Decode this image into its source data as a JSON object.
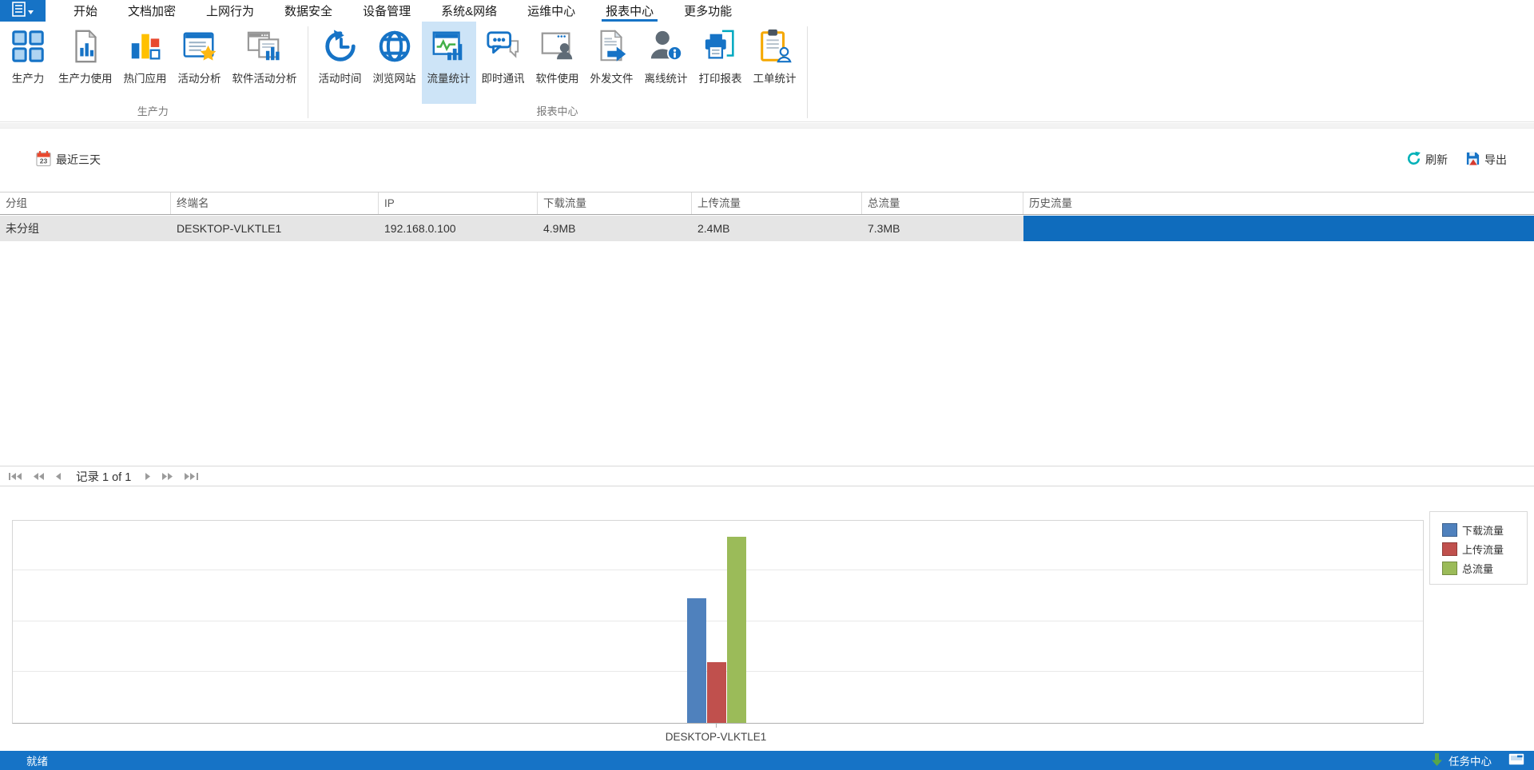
{
  "menubar": {
    "tabs": [
      {
        "id": "home",
        "label": "开始"
      },
      {
        "id": "doc-encryption",
        "label": "文档加密"
      },
      {
        "id": "web-behavior",
        "label": "上网行为"
      },
      {
        "id": "data-security",
        "label": "数据安全"
      },
      {
        "id": "device-management",
        "label": "设备管理"
      },
      {
        "id": "system-network",
        "label": "系统&网络"
      },
      {
        "id": "ops-center",
        "label": "运维中心"
      },
      {
        "id": "report-center",
        "label": "报表中心",
        "active": true
      },
      {
        "id": "more-features",
        "label": "更多功能"
      }
    ]
  },
  "ribbon": {
    "groups": [
      {
        "id": "productivity-group",
        "label": "生产力",
        "buttons": [
          {
            "id": "productivity",
            "label": "生产力",
            "icon": "grid-squares-icon"
          },
          {
            "id": "productivity-usage",
            "label": "生产力使用",
            "icon": "document-barchart-icon"
          },
          {
            "id": "popular-apps",
            "label": "热门应用",
            "icon": "popular-apps-icon"
          },
          {
            "id": "activity-analysis",
            "label": "活动分析",
            "icon": "starred-report-icon"
          },
          {
            "id": "software-activity-analysis",
            "label": "软件活动分析",
            "icon": "software-activity-icon"
          }
        ]
      },
      {
        "id": "report-center-group",
        "label": "报表中心",
        "buttons": [
          {
            "id": "activity-time",
            "label": "活动时间",
            "icon": "activity-time-icon"
          },
          {
            "id": "browse-website",
            "label": "浏览网站",
            "icon": "globe-icon"
          },
          {
            "id": "traffic-stats",
            "label": "流量统计",
            "icon": "traffic-stats-icon",
            "selected": true
          },
          {
            "id": "instant-messaging",
            "label": "即时通讯",
            "icon": "chat-bubbles-icon"
          },
          {
            "id": "software-usage",
            "label": "软件使用",
            "icon": "software-usage-icon"
          },
          {
            "id": "outgoing-files",
            "label": "外发文件",
            "icon": "outgoing-file-icon"
          },
          {
            "id": "offline-stats",
            "label": "离线统计",
            "icon": "offline-user-icon"
          },
          {
            "id": "print-report",
            "label": "打印报表",
            "icon": "printer-icon"
          },
          {
            "id": "work-order-stats",
            "label": "工单统计",
            "icon": "work-order-icon"
          }
        ]
      }
    ]
  },
  "toolbar": {
    "date_filter": "最近三天",
    "calendar_day": "23",
    "refresh_label": "刷新",
    "export_label": "导出"
  },
  "grid": {
    "columns": [
      "分组",
      "终端名",
      "IP",
      "下载流量",
      "上传流量",
      "总流量",
      "历史流量"
    ],
    "rows": [
      {
        "cells": [
          "未分组",
          "DESKTOP-VLKTLE1",
          "192.168.0.100",
          "4.9MB",
          "2.4MB",
          "7.3MB"
        ],
        "history_bar_fraction": 1
      }
    ]
  },
  "pager": {
    "record_text": "记录 1 of 1"
  },
  "chart_data": {
    "type": "bar",
    "title": "",
    "categories": [
      "DESKTOP-VLKTLE1"
    ],
    "series": [
      {
        "name": "下载流量",
        "values": [
          4.9
        ],
        "color": "#4f81bd"
      },
      {
        "name": "上传流量",
        "values": [
          2.4
        ],
        "color": "#c0504d"
      },
      {
        "name": "总流量",
        "values": [
          7.3
        ],
        "color": "#9bbb59"
      }
    ],
    "unit": "MB",
    "ylim": [
      0,
      8
    ],
    "gridline_step": 2,
    "grid": true,
    "y_tick_labels_visible": false,
    "legend_position": "top-right"
  },
  "statusbar": {
    "left": "就绪",
    "task_center": "任务中心"
  },
  "colors": {
    "accent_blue": "#1673c6",
    "ribbon_selected_bg": "#cde4f7",
    "row_bg": "#e5e5e5",
    "history_bar_blue": "#0f6cbd",
    "statusbar_blue": "#1673c6",
    "refresh_teal": "#00b1b8",
    "calendar_red": "#e8492f",
    "download_arrow_green": "#57a64a"
  }
}
